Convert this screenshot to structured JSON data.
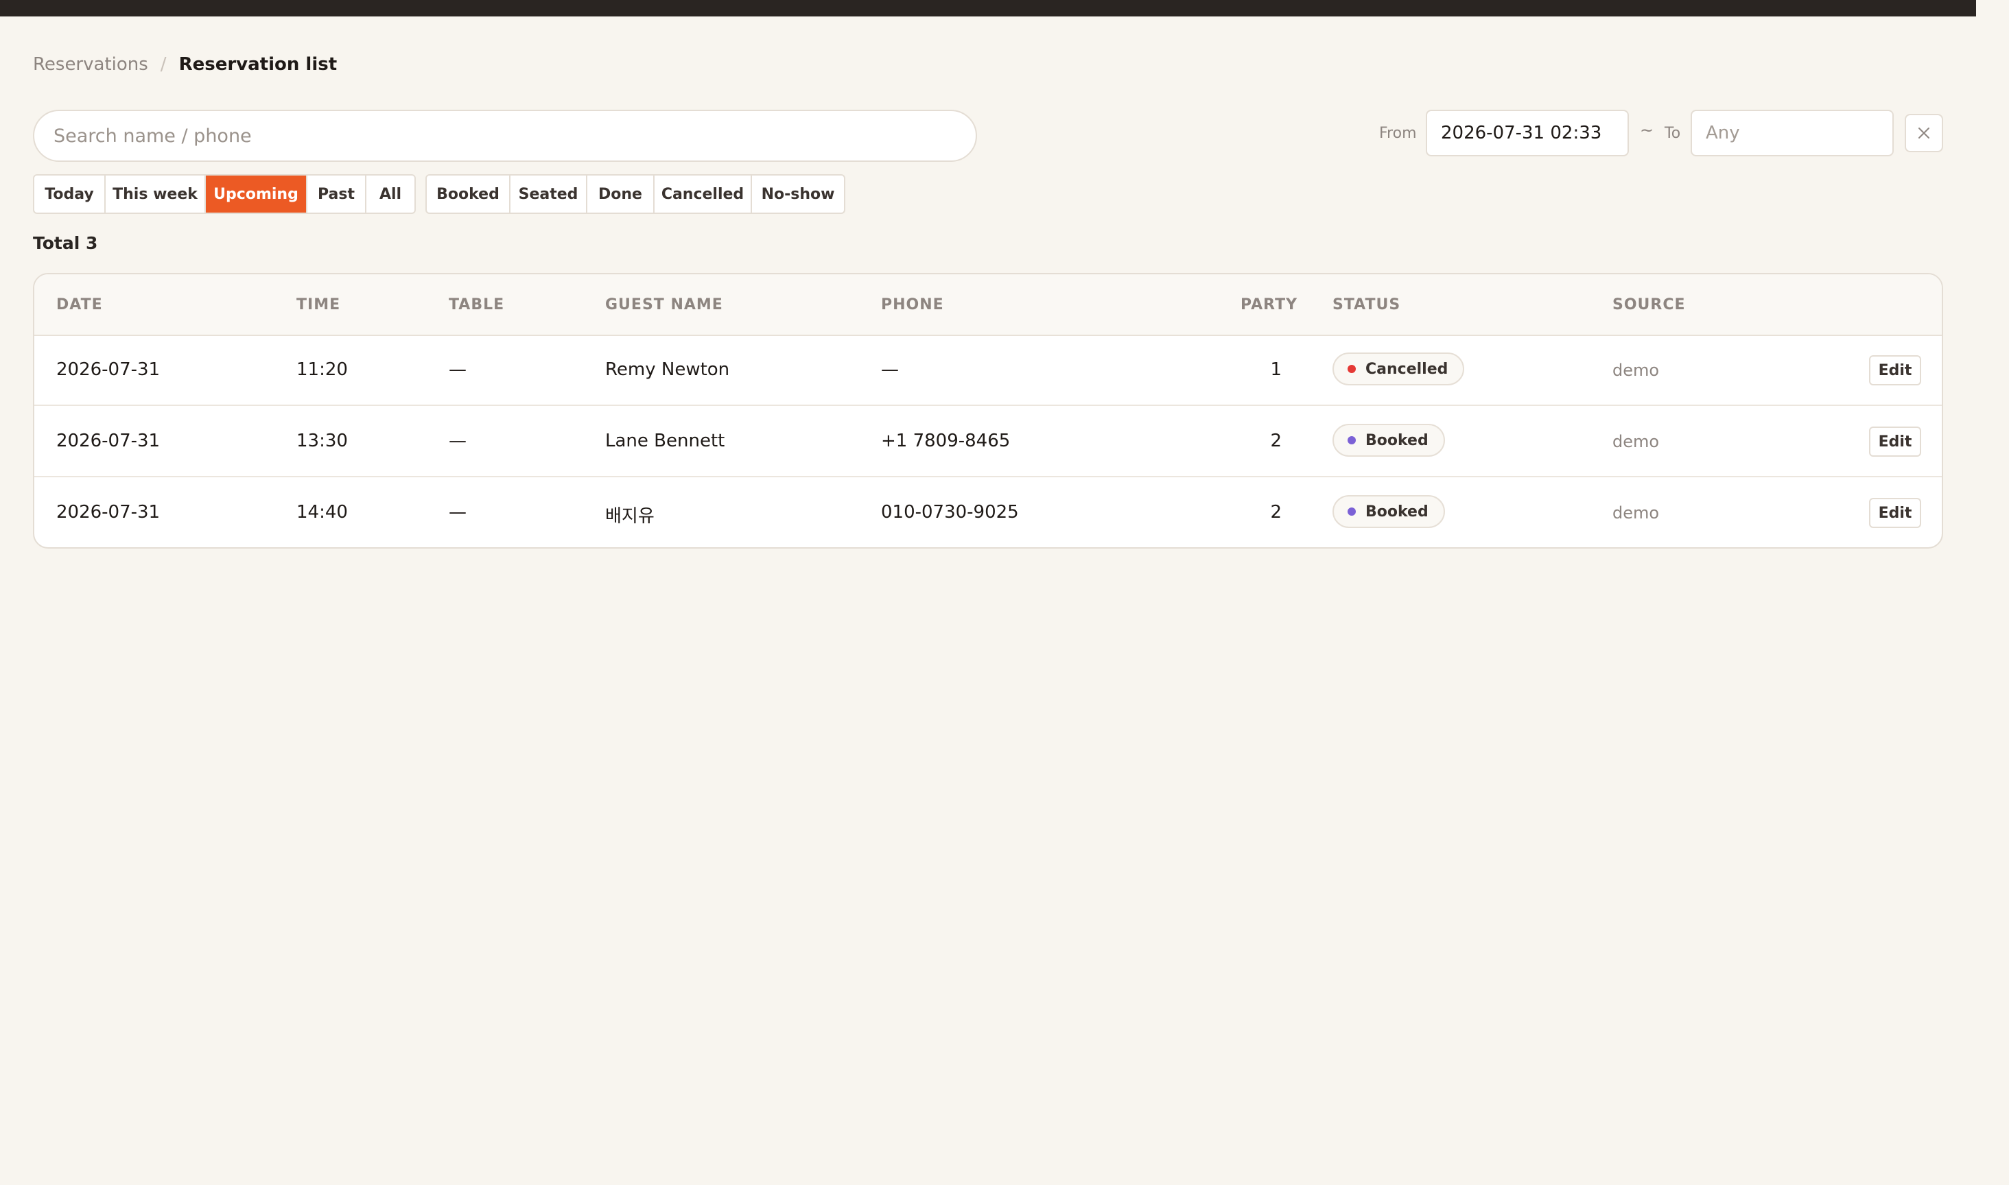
{
  "breadcrumb": {
    "parent": "Reservations",
    "separator": "/",
    "current": "Reservation list"
  },
  "search": {
    "placeholder": "Search name / phone",
    "value": ""
  },
  "date_range": {
    "from_label": "From",
    "from_value": "2026-07-31 02:33",
    "separator": "~",
    "to_label": "To",
    "to_placeholder": "Any",
    "clear_icon": "close-icon"
  },
  "period_filters": [
    {
      "label": "Today",
      "active": false
    },
    {
      "label": "This week",
      "active": false
    },
    {
      "label": "Upcoming",
      "active": true
    },
    {
      "label": "Past",
      "active": false
    },
    {
      "label": "All",
      "active": false
    }
  ],
  "status_filters": [
    {
      "label": "Booked"
    },
    {
      "label": "Seated"
    },
    {
      "label": "Done"
    },
    {
      "label": "Cancelled"
    },
    {
      "label": "No-show"
    }
  ],
  "total": "Total 3",
  "table": {
    "columns": [
      "DATE",
      "TIME",
      "TABLE",
      "GUEST NAME",
      "PHONE",
      "PARTY",
      "STATUS",
      "SOURCE"
    ],
    "rows": [
      {
        "date": "2026-07-31",
        "time": "11:20",
        "table": "—",
        "guest": "Remy Newton",
        "phone": "—",
        "party": "1",
        "status": "Cancelled",
        "status_color": "#e53935",
        "source": "demo",
        "action": "Edit"
      },
      {
        "date": "2026-07-31",
        "time": "13:30",
        "table": "—",
        "guest": "Lane Bennett",
        "phone": "+1 7809-8465",
        "party": "2",
        "status": "Booked",
        "status_color": "#7b61d6",
        "source": "demo",
        "action": "Edit"
      },
      {
        "date": "2026-07-31",
        "time": "14:40",
        "table": "—",
        "guest": "배지유",
        "phone": "010-0730-9025",
        "party": "2",
        "status": "Booked",
        "status_color": "#7b61d6",
        "source": "demo",
        "action": "Edit"
      }
    ]
  },
  "colors": {
    "accent": "#ec5a24",
    "background": "#f8f5ef",
    "topbar": "#2a2522"
  }
}
